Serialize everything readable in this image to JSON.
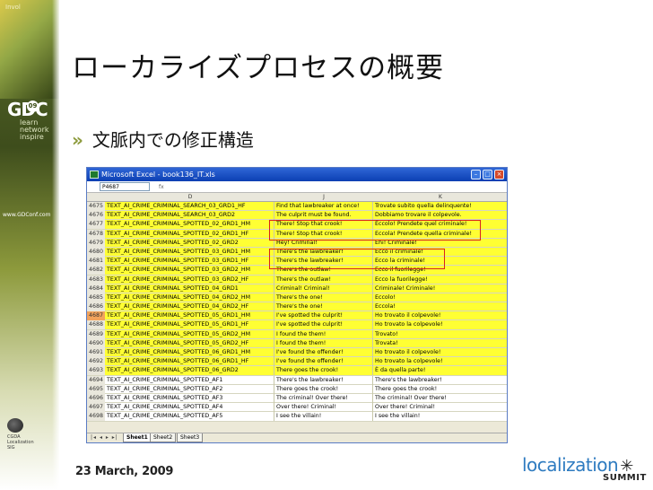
{
  "left_band": {
    "top_small": "Invol",
    "url": "www.GDConf.com",
    "gdc": "GDC",
    "gdc_ball": "09",
    "gdc_words": [
      "learn",
      "network",
      "inspire"
    ],
    "cgda_text": [
      "CGDA",
      "Localization",
      "SIG"
    ]
  },
  "slide": {
    "title": "ローカライズプロセスの概要",
    "bullet_mark": "»",
    "bullet": "文脈内での修正構造"
  },
  "excel": {
    "window_title": "Microsoft Excel - book136_IT.xls",
    "name_box": "P4687",
    "fx_label": "fx",
    "columns": [
      "D",
      "J",
      "K"
    ],
    "rows": [
      {
        "n": "4675",
        "d": "TEXT_AI_CRIME_CRIMINAL_SEARCH_03_GRD1_HF",
        "j": "Find that lawbreaker at once!",
        "k": "Trovate subito quella delinquente!",
        "hl": true
      },
      {
        "n": "4676",
        "d": "TEXT_AI_CRIME_CRIMINAL_SEARCH_03_GRD2",
        "j": "The culprit must be found.",
        "k": "Dobbiamo trovare il colpevole.",
        "hl": true
      },
      {
        "n": "4677",
        "d": "TEXT_AI_CRIME_CRIMINAL_SPOTTED_02_GRD1_HM",
        "j": "There! Stop that crook!",
        "k": "Eccolo! Prendete quel criminale!",
        "hl": true
      },
      {
        "n": "4678",
        "d": "TEXT_AI_CRIME_CRIMINAL_SPOTTED_02_GRD1_HF",
        "j": "There! Stop that crook!",
        "k": "Eccola! Prendete quella criminale!",
        "hl": true
      },
      {
        "n": "4679",
        "d": "TEXT_AI_CRIME_CRIMINAL_SPOTTED_02_GRD2",
        "j": "Hey! Criminal!",
        "k": "Ehi! Criminale!",
        "hl": true
      },
      {
        "n": "4680",
        "d": "TEXT_AI_CRIME_CRIMINAL_SPOTTED_03_GRD1_HM",
        "j": "There's the lawbreaker!",
        "k": "Ecco il criminale!",
        "hl": true
      },
      {
        "n": "4681",
        "d": "TEXT_AI_CRIME_CRIMINAL_SPOTTED_03_GRD1_HF",
        "j": "There's the lawbreaker!",
        "k": "Ecco la criminale!",
        "hl": true
      },
      {
        "n": "4682",
        "d": "TEXT_AI_CRIME_CRIMINAL_SPOTTED_03_GRD2_HM",
        "j": "There's the outlaw!",
        "k": "Ecco il fuorilegge!",
        "hl": true
      },
      {
        "n": "4683",
        "d": "TEXT_AI_CRIME_CRIMINAL_SPOTTED_03_GRD2_HF",
        "j": "There's the outlaw!",
        "k": "Ecco la fuorilegge!",
        "hl": true
      },
      {
        "n": "4684",
        "d": "TEXT_AI_CRIME_CRIMINAL_SPOTTED_04_GRD1",
        "j": "Criminal! Criminal!",
        "k": "Criminale! Criminale!",
        "hl": true
      },
      {
        "n": "4685",
        "d": "TEXT_AI_CRIME_CRIMINAL_SPOTTED_04_GRD2_HM",
        "j": "There's the one!",
        "k": "Eccolo!",
        "hl": true
      },
      {
        "n": "4686",
        "d": "TEXT_AI_CRIME_CRIMINAL_SPOTTED_04_GRD2_HF",
        "j": "There's the one!",
        "k": "Eccola!",
        "hl": true
      },
      {
        "n": "4687",
        "d": "TEXT_AI_CRIME_CRIMINAL_SPOTTED_05_GRD1_HM",
        "j": "I've spotted the culprit!",
        "k": "Ho trovato il colpevole!",
        "hl": true,
        "sel": true
      },
      {
        "n": "4688",
        "d": "TEXT_AI_CRIME_CRIMINAL_SPOTTED_05_GRD1_HF",
        "j": "I've spotted the culprit!",
        "k": "Ho trovato la colpevole!",
        "hl": true
      },
      {
        "n": "4689",
        "d": "TEXT_AI_CRIME_CRIMINAL_SPOTTED_05_GRD2_HM",
        "j": "I found the them!",
        "k": "Trovato!",
        "hl": true
      },
      {
        "n": "4690",
        "d": "TEXT_AI_CRIME_CRIMINAL_SPOTTED_05_GRD2_HF",
        "j": "I found the them!",
        "k": "Trovata!",
        "hl": true
      },
      {
        "n": "4691",
        "d": "TEXT_AI_CRIME_CRIMINAL_SPOTTED_06_GRD1_HM",
        "j": "I've found the offender!",
        "k": "Ho trovato il colpevole!",
        "hl": true
      },
      {
        "n": "4692",
        "d": "TEXT_AI_CRIME_CRIMINAL_SPOTTED_06_GRD1_HF",
        "j": "I've found the offender!",
        "k": "Ho trovato la colpevole!",
        "hl": true
      },
      {
        "n": "4693",
        "d": "TEXT_AI_CRIME_CRIMINAL_SPOTTED_06_GRD2",
        "j": "There goes the crook!",
        "k": "È da quella parte!",
        "hl": true
      },
      {
        "n": "4694",
        "d": "TEXT_AI_CRIME_CRIMINAL_SPOTTED_AF1",
        "j": "There's the lawbreaker!",
        "k": "There's the lawbreaker!",
        "hl": false
      },
      {
        "n": "4695",
        "d": "TEXT_AI_CRIME_CRIMINAL_SPOTTED_AF2",
        "j": "There goes the crook!",
        "k": "There goes the crook!",
        "hl": false
      },
      {
        "n": "4696",
        "d": "TEXT_AI_CRIME_CRIMINAL_SPOTTED_AF3",
        "j": "The criminal! Over there!",
        "k": "The criminal! Over there!",
        "hl": false
      },
      {
        "n": "4697",
        "d": "TEXT_AI_CRIME_CRIMINAL_SPOTTED_AF4",
        "j": "Over there! Criminal!",
        "k": "Over there! Criminal!",
        "hl": false
      },
      {
        "n": "4698",
        "d": "TEXT_AI_CRIME_CRIMINAL_SPOTTED_AF5",
        "j": "I see the villain!",
        "k": "I see the villain!",
        "hl": false
      }
    ],
    "tabs": [
      "Sheet1",
      "Sheet2",
      "Sheet3"
    ],
    "tab_nav": "|◂ ◂ ▸ ▸|"
  },
  "footer": {
    "date": "23 March, 2009",
    "brand": "localization",
    "brand_sub": "SUMMIT"
  }
}
